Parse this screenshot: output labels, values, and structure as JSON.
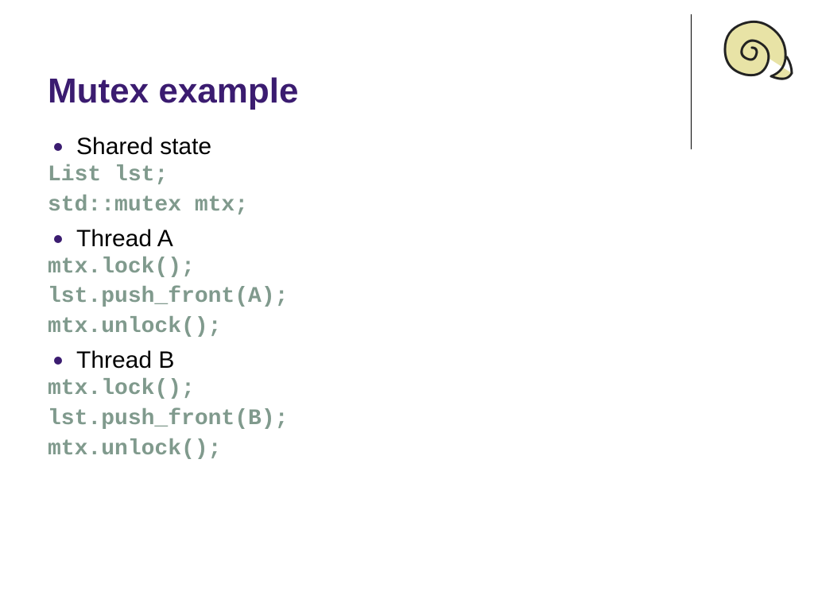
{
  "title": "Mutex example",
  "sections": [
    {
      "bullet": "Shared state",
      "code": [
        "List lst;",
        "std::mutex mtx;"
      ]
    },
    {
      "bullet": "Thread A",
      "code": [
        "mtx.lock();",
        "lst.push_front(A);",
        "mtx.unlock();"
      ]
    },
    {
      "bullet": "Thread B",
      "code": [
        "mtx.lock();",
        "lst.push_front(B);",
        "mtx.unlock();"
      ]
    }
  ]
}
